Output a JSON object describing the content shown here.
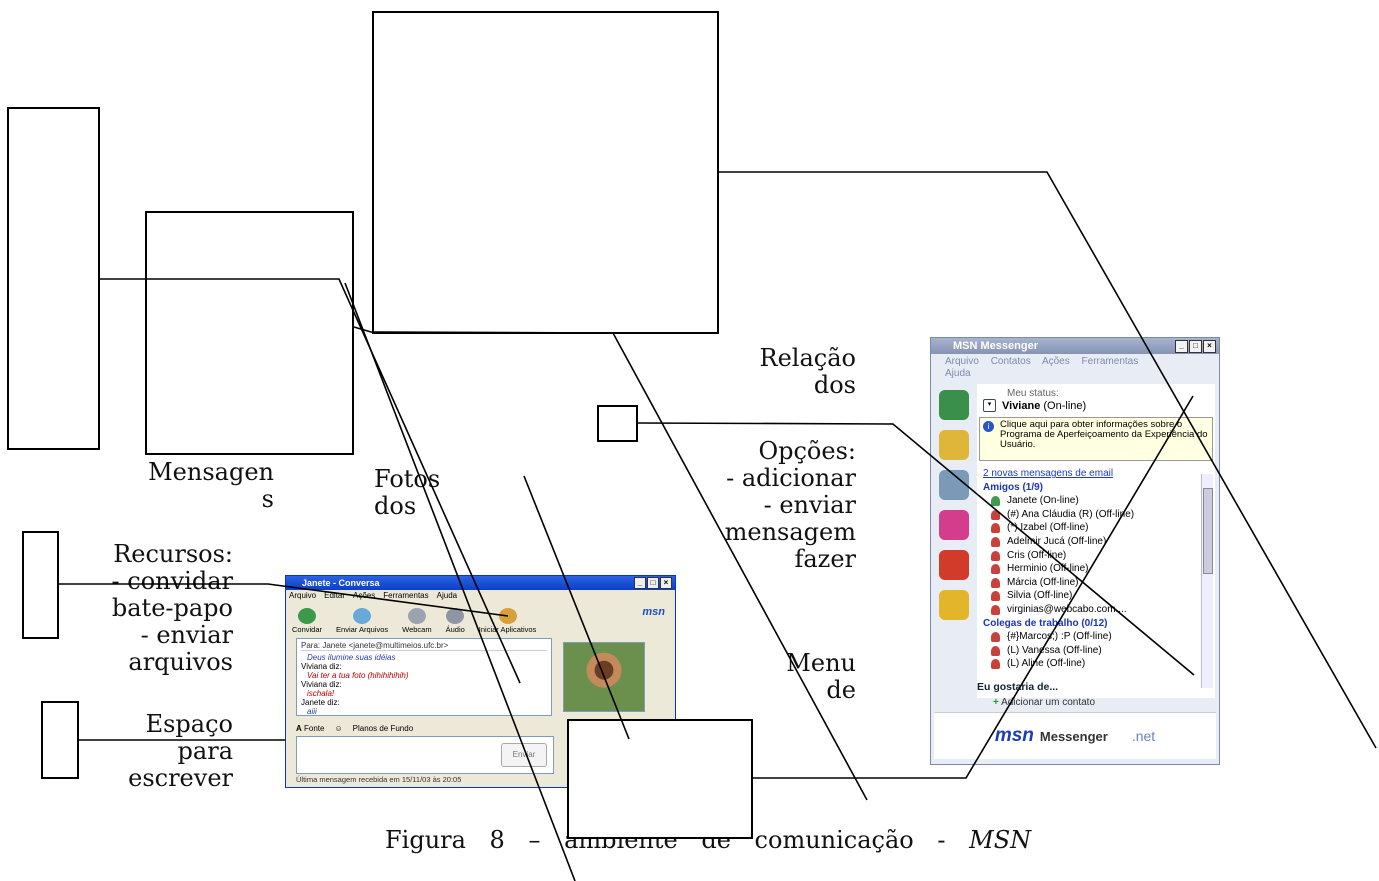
{
  "labels": {
    "relacao": [
      "Relação",
      "dos"
    ],
    "opcoes": [
      "Opções:",
      "- adicionar",
      "- enviar",
      "mensagem",
      "fazer"
    ],
    "menu": [
      "Menu",
      "de"
    ],
    "mensagens": [
      "Mensagen",
      "s"
    ],
    "fotos": [
      "Fotos",
      "dos"
    ],
    "recursos": [
      "Recursos:",
      "- convidar",
      "bate-papo",
      "- enviar",
      "arquivos"
    ],
    "espaco": [
      "Espaço",
      "para",
      "escrever"
    ]
  },
  "caption": {
    "prefix": "Figura 8 –",
    "middle": "ambiente de comunicação -",
    "emph": "MSN"
  },
  "conversation_window": {
    "title": "Janete - Conversa",
    "menu": [
      "Arquivo",
      "Editar",
      "Ações",
      "Ferramentas",
      "Ajuda"
    ],
    "tools": [
      "Convidar",
      "Enviar Arquivos",
      "Webcam",
      "Áudio",
      "Iniciar Aplicativos"
    ],
    "logo": "msn",
    "to_line": "Para: Janete <janete@multimeios.ufc.br>",
    "messages": [
      {
        "type": "hand",
        "text": "Deus ilumine suas idéias"
      },
      {
        "type": "speaker",
        "text": "Viviana diz:"
      },
      {
        "type": "red",
        "text": "Vai ter a tua foto (hihihihihih)"
      },
      {
        "type": "speaker",
        "text": "Viviana diz:"
      },
      {
        "type": "red",
        "text": "ischala!"
      },
      {
        "type": "speaker",
        "text": "Janete diz:"
      },
      {
        "type": "hand",
        "text": "aiii"
      }
    ],
    "format_bar": [
      "Fonte",
      "Planos de Fundo"
    ],
    "send": "Enviar",
    "status": "Última mensagem recebida em 15/11/03 às 20:05"
  },
  "messenger_window": {
    "title": "MSN Messenger",
    "menu": [
      "Arquivo",
      "Contatos",
      "Ações",
      "Ferramentas",
      "Ajuda"
    ],
    "status_label": "Meu status:",
    "user": "Viviane",
    "user_status": "(On-line)",
    "info": "Clique aqui para obter informações sobre o Programa de Aperfeiçoamento da Experiência do Usuário.",
    "mail": "2 novas mensagens de email",
    "group1": "Amigos (1/9)",
    "contacts1": [
      {
        "name": "Janete (On-line)",
        "online": true
      },
      {
        "name": "(#) Ana Cláudia (R) (Off-line)",
        "online": false
      },
      {
        "name": "(*) Izabel (Off-line)",
        "online": false
      },
      {
        "name": "Adelmir Jucá (Off-line)",
        "online": false
      },
      {
        "name": "Cris (Off-line)",
        "online": false
      },
      {
        "name": "Herminio (Off-line)",
        "online": false
      },
      {
        "name": "Márcia (Off-line)",
        "online": false
      },
      {
        "name": "Silvia (Off-line)",
        "online": false
      },
      {
        "name": "virginias@webcabo.com....",
        "online": false
      }
    ],
    "group2": "Colegas de trabalho (0/12)",
    "contacts2": [
      {
        "name": "{#}Marcos;) :P (Off-line)",
        "online": false
      },
      {
        "name": "(L) Vanessa (Off-line)",
        "online": false
      },
      {
        "name": "(L) Aline (Off-line)",
        "online": false
      }
    ],
    "wish": "Eu gostaria de...",
    "add_contact": "Adicionar um contato",
    "brand_msn": "msn",
    "brand_messenger": "Messenger",
    "brand_net": ".net"
  },
  "colors": {
    "xp_blue": "#0a3fc9",
    "msn_blue": "#1a3fb3",
    "info_yellow": "#ffffe1"
  }
}
